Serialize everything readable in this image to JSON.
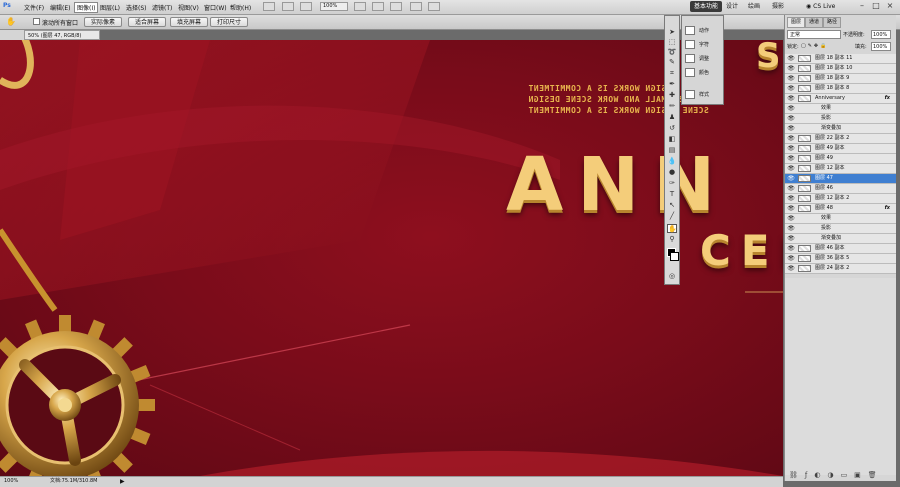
{
  "app": {
    "logo": "Ps"
  },
  "menu": {
    "items": [
      "文件(F)",
      "编辑(E)",
      "图像(I)",
      "图层(L)",
      "选择(S)",
      "滤镜(T)",
      "视图(V)",
      "窗口(W)",
      "帮助(H)"
    ],
    "zoom": "100%"
  },
  "workspace": {
    "items": [
      "基本功能",
      "设计",
      "绘画",
      "摄影"
    ],
    "cs_live": "CS Live"
  },
  "options": {
    "scroll_all_label": "滚动所有窗口",
    "buttons": [
      "实际像素",
      "适合屏幕",
      "填充屏幕",
      "打印尺寸"
    ]
  },
  "document": {
    "tab_title": "50% (图层 47, RGB/8)"
  },
  "canvas": {
    "top_letter": "S",
    "headline": "ANN",
    "subline": "CEL",
    "mirror_lines": [
      "DESIGN WORKS IS A COMMITMENT",
      "S SMALL AND WORK SCENE DESIGN",
      "SCENE DESIGN WORKS IS A COMMITMENT"
    ]
  },
  "status": {
    "zoom": "100%",
    "doc": "文档:75.1M/310.8M"
  },
  "float_panel": {
    "items": [
      "动作",
      "字符",
      "调整",
      "颜色",
      "样式"
    ]
  },
  "layers_panel": {
    "tabs": [
      "图层",
      "通道",
      "路径"
    ],
    "blend_mode": "正常",
    "opacity_label": "不透明度:",
    "opacity_value": "100%",
    "lock_label": "锁定:",
    "fill_label": "填充:",
    "fill_value": "100%",
    "rows": [
      {
        "name": "图层 18 副本 11",
        "type": "layer"
      },
      {
        "name": "图层 18 副本 10",
        "type": "layer"
      },
      {
        "name": "图层 18 副本 9",
        "type": "layer"
      },
      {
        "name": "图层 18 副本 8",
        "type": "layer"
      },
      {
        "name": "Anniversary",
        "type": "layer",
        "fx": "fx"
      },
      {
        "name": "效果",
        "type": "effect"
      },
      {
        "name": "投影",
        "type": "effect"
      },
      {
        "name": "渐变叠加",
        "type": "effect"
      },
      {
        "name": "图层 22 副本 2",
        "type": "layer"
      },
      {
        "name": "图层 49 副本",
        "type": "layer"
      },
      {
        "name": "图层 49",
        "type": "layer"
      },
      {
        "name": "图层 12 副本",
        "type": "layer"
      },
      {
        "name": "图层 47",
        "type": "layer",
        "selected": true
      },
      {
        "name": "图层 46",
        "type": "layer"
      },
      {
        "name": "图层 12 副本 2",
        "type": "layer"
      },
      {
        "name": "图层 48",
        "type": "layer",
        "fx": "fx"
      },
      {
        "name": "效果",
        "type": "effect"
      },
      {
        "name": "投影",
        "type": "effect"
      },
      {
        "name": "渐变叠加",
        "type": "effect"
      },
      {
        "name": "图层 46 副本",
        "type": "layer"
      },
      {
        "name": "图层 36 副本 5",
        "type": "layer"
      },
      {
        "name": "图层 24 副本 2",
        "type": "layer"
      }
    ]
  },
  "colors": {
    "accent": "#3f7fd1",
    "gold": "#f4cd7a",
    "canvas_red": "#7a0c1a"
  }
}
